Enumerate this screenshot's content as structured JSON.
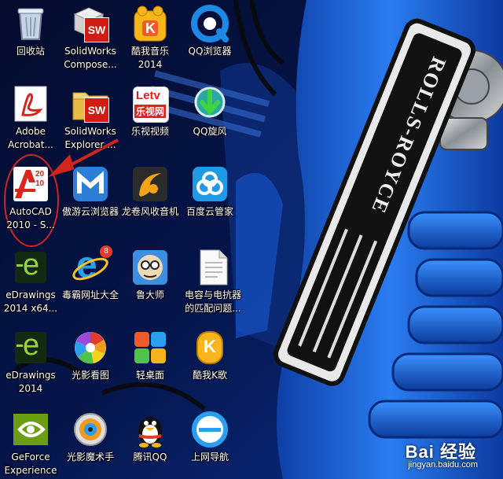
{
  "desktop": {
    "icons": [
      {
        "label": "回收站",
        "icon": "recycle-bin-icon"
      },
      {
        "label": "SolidWorks\nCompose...",
        "icon": "solidworks-compose-icon"
      },
      {
        "label": "酷我音乐\n2014",
        "icon": "kuwo-music-icon"
      },
      {
        "label": "QQ浏览器",
        "icon": "qq-browser-icon"
      },
      {
        "label": "Adobe\nAcrobat...",
        "icon": "adobe-acrobat-icon"
      },
      {
        "label": "SolidWorks\nExplorer ...",
        "icon": "solidworks-explorer-icon"
      },
      {
        "label": "乐视视频",
        "icon": "letv-icon"
      },
      {
        "label": "QQ旋风",
        "icon": "qq-whirlwind-icon"
      },
      {
        "label": "AutoCAD\n2010 - S...",
        "icon": "autocad-icon"
      },
      {
        "label": "傲游云浏览器",
        "icon": "maxthon-icon"
      },
      {
        "label": "龙卷风收音机",
        "icon": "tornado-radio-icon"
      },
      {
        "label": "百度云管家",
        "icon": "baidu-cloud-icon"
      },
      {
        "label": "eDrawings\n2014 x64...",
        "icon": "edrawings-icon"
      },
      {
        "label": "毒霸网址大全",
        "icon": "ie-icon"
      },
      {
        "label": "鲁大师",
        "icon": "ludashi-icon"
      },
      {
        "label": "电容与电抗器\n的匹配问题...",
        "icon": "text-document-icon"
      },
      {
        "label": "eDrawings\n2014",
        "icon": "edrawings-icon"
      },
      {
        "label": "光影看图",
        "icon": "photo-viewer-icon"
      },
      {
        "label": "轻桌面",
        "icon": "light-desktop-icon"
      },
      {
        "label": "酷我K歌",
        "icon": "kuwo-ksong-icon"
      },
      {
        "label": "GeForce\nExperience",
        "icon": "nvidia-geforce-icon"
      },
      {
        "label": "光影魔术手",
        "icon": "photo-magic-icon"
      },
      {
        "label": "腾讯QQ",
        "icon": "qq-penguin-icon"
      },
      {
        "label": "上网导航",
        "icon": "ie-nav-icon"
      }
    ],
    "icon_glyphs": {
      "sw": "SW",
      "kuwo": "K",
      "letv_top": "Letv",
      "letv_bottom": "乐视网",
      "autocad_year_top": "20",
      "autocad_year_bottom": "10",
      "ie_badge": "8",
      "edrawings_letter": "e",
      "ie_letter": "e"
    },
    "wallpaper_badge": "ROLLS-ROYCE",
    "watermark": {
      "brand": "Bai 经验",
      "url": "jingyan.baidu.com"
    },
    "annotation_color": "#d0241c"
  }
}
